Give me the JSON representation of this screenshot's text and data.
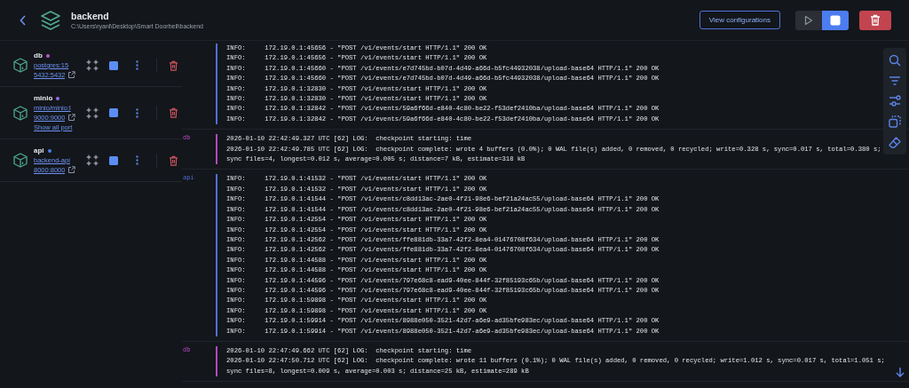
{
  "header": {
    "title": "backend",
    "path": "C:\\Users\\ryanl\\Desktop\\Smart Doorbell\\backend",
    "config_button": "View configurations",
    "play_disabled": true,
    "stop_active": true
  },
  "containers": [
    {
      "name": "db",
      "color": "#c552d6",
      "image": "postgres:15",
      "port": "5432:5432"
    },
    {
      "name": "minio",
      "color": "#9a6ce8",
      "image": "minio/minio:l",
      "port": "9000:9000",
      "more": "Show all port"
    },
    {
      "name": "api",
      "color": "#4f7fe6",
      "image": "backend-api",
      "port": "8000:8000"
    }
  ],
  "log_groups": [
    {
      "color": "#4f6fd6",
      "lines": [
        "INFO:     172.19.0.1:45656 - \"POST /v1/events/start HTTP/1.1\" 200 OK",
        "INFO:     172.19.0.1:45656 - \"POST /v1/events/start HTTP/1.1\" 200 OK",
        "INFO:     172.19.0.1:45660 - \"POST /v1/events/e7d745bd-b07d-4d49-a66d-b5fc44932038/upload-base64 HTTP/1.1\" 200 OK",
        "INFO:     172.19.0.1:45660 - \"POST /v1/events/e7d745bd-b07d-4d49-a66d-b5fc44932038/upload-base64 HTTP/1.1\" 200 OK",
        "INFO:     172.19.0.1:32830 - \"POST /v1/events/start HTTP/1.1\" 200 OK",
        "INFO:     172.19.0.1:32830 - \"POST /v1/events/start HTTP/1.1\" 200 OK",
        "INFO:     172.19.0.1:32842 - \"POST /v1/events/59a6f66d-e840-4c80-be22-f53def2410ba/upload-base64 HTTP/1.1\" 200 OK",
        "INFO:     172.19.0.1:32842 - \"POST /v1/events/59a6f66d-e840-4c80-be22-f53def2410ba/upload-base64 HTTP/1.1\" 200 OK"
      ]
    },
    {
      "service": "db",
      "color": "#b04ac0",
      "lines": [
        "2026-01-10 22:42:49.327 UTC [62] LOG:  checkpoint starting: time",
        "2026-01-10 22:42:49.785 UTC [62] LOG:  checkpoint complete: wrote 4 buffers (0.0%); 0 WAL file(s) added, 0 removed, 0 recycled; write=0.328 s, sync=0.017 s, total=0.380 s; sync files=4, longest=0.012 s, average=0.005 s; distance=7 kB, estimate=318 kB"
      ]
    },
    {
      "service": "api",
      "color": "#4f6fd6",
      "lines": [
        "INFO:     172.19.0.1:41532 - \"POST /v1/events/start HTTP/1.1\" 200 OK",
        "INFO:     172.19.0.1:41532 - \"POST /v1/events/start HTTP/1.1\" 200 OK",
        "INFO:     172.19.0.1:41544 - \"POST /v1/events/c8dd13ac-2ae0-4f21-98e6-bef21a24ac55/upload-base64 HTTP/1.1\" 200 OK",
        "INFO:     172.19.0.1:41544 - \"POST /v1/events/c8dd13ac-2ae0-4f21-98e6-bef21a24ac55/upload-base64 HTTP/1.1\" 200 OK",
        "INFO:     172.19.0.1:42554 - \"POST /v1/events/start HTTP/1.1\" 200 OK",
        "INFO:     172.19.0.1:42554 - \"POST /v1/events/start HTTP/1.1\" 200 OK",
        "INFO:     172.19.0.1:42562 - \"POST /v1/events/ffe881db-33a7-42f2-8ea4-01476708f634/upload-base64 HTTP/1.1\" 200 OK",
        "INFO:     172.19.0.1:42562 - \"POST /v1/events/ffe881db-33a7-42f2-8ea4-01476708f634/upload-base64 HTTP/1.1\" 200 OK",
        "INFO:     172.19.0.1:44588 - \"POST /v1/events/start HTTP/1.1\" 200 OK",
        "INFO:     172.19.0.1:44588 - \"POST /v1/events/start HTTP/1.1\" 200 OK",
        "INFO:     172.19.0.1:44596 - \"POST /v1/events/797e68c8-ead9-40ee-844f-32f85193c65b/upload-base64 HTTP/1.1\" 200 OK",
        "INFO:     172.19.0.1:44596 - \"POST /v1/events/797e68c8-ead9-40ee-844f-32f85193c65b/upload-base64 HTTP/1.1\" 200 OK",
        "INFO:     172.19.0.1:59898 - \"POST /v1/events/start HTTP/1.1\" 200 OK",
        "INFO:     172.19.0.1:59898 - \"POST /v1/events/start HTTP/1.1\" 200 OK",
        "INFO:     172.19.0.1:59914 - \"POST /v1/events/8988e050-3521-42d7-a6e9-ad35bfe983ec/upload-base64 HTTP/1.1\" 200 OK",
        "INFO:     172.19.0.1:59914 - \"POST /v1/events/8988e050-3521-42d7-a6e9-ad35bfe983ec/upload-base64 HTTP/1.1\" 200 OK"
      ]
    },
    {
      "service": "db",
      "color": "#b04ac0",
      "lines": [
        "2026-01-10 22:47:49.662 UTC [62] LOG:  checkpoint starting: time",
        "2026-01-10 22:47:50.712 UTC [62] LOG:  checkpoint complete: wrote 11 buffers (0.1%); 0 WAL file(s) added, 0 removed, 0 recycled; write=1.012 s, sync=0.017 s, total=1.051 s; sync files=8, longest=0.009 s, average=0.003 s; distance=25 kB, estimate=289 kB"
      ]
    }
  ]
}
